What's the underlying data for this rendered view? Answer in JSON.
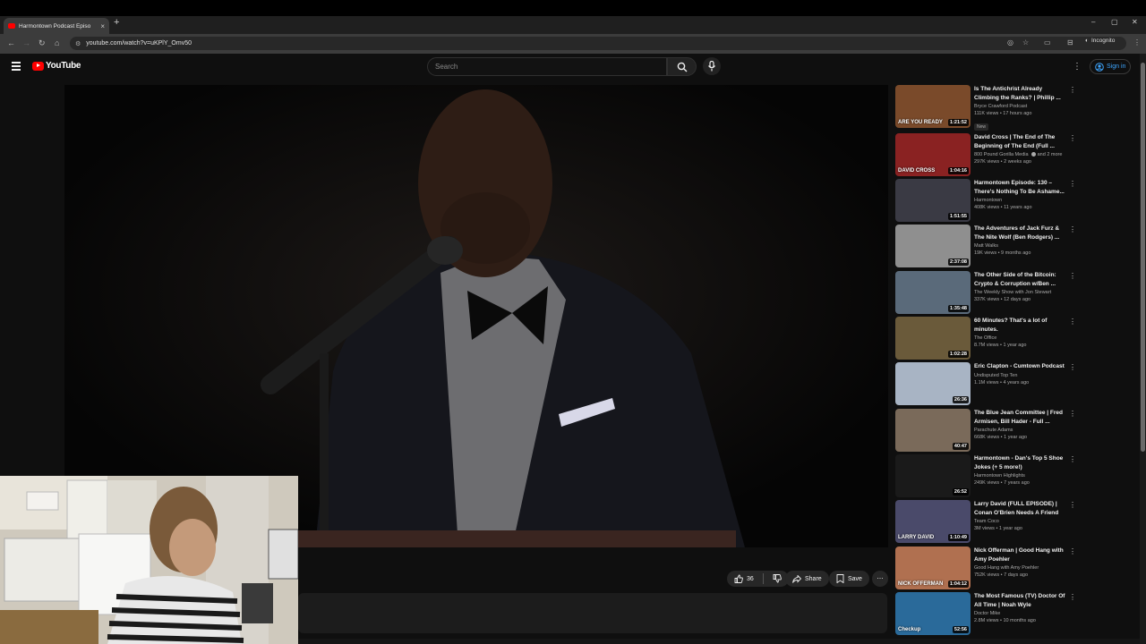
{
  "browser": {
    "tab_title": "Harmontown Podcast Episo",
    "new_tab_symbol": "+",
    "url": "youtube.com/watch?v=uKPlY_Omv50",
    "incognito_label": "Incognito",
    "controls": {
      "minimize": "–",
      "maximize": "▢",
      "close": "✕"
    }
  },
  "header": {
    "logo_text": "YouTube",
    "search_placeholder": "Search",
    "signin_label": "Sign in"
  },
  "actions": {
    "like_count": "36",
    "share_label": "Share",
    "save_label": "Save",
    "more_label": "⋯"
  },
  "icons": {
    "menu": "hamburger-icon",
    "search": "search-icon",
    "mic": "mic-icon",
    "like": "thumbs-up-icon",
    "dislike": "thumbs-down-icon",
    "share": "share-icon",
    "save": "save-icon",
    "more": "more-vert-icon",
    "account": "account-icon"
  },
  "colors": {
    "accent": "#ff0000",
    "link": "#3ea6ff",
    "background": "#0f0f0f"
  },
  "recommendations": [
    {
      "title": "Is The Antichrist Already Climbing the Ranks? | Phillip ...",
      "channel": "Bryce Crawford Podcast",
      "meta": "111K views • 17 hours ago",
      "badge": "New",
      "duration": "1:21:52",
      "thumb_color": "#7a4a2a",
      "thumb_text": "ARE YOU READY"
    },
    {
      "title": "David Cross | The End of The Beginning of The End (Full ...",
      "channel": "800 Pound Gorilla Media",
      "channel_extra": "and 2 more",
      "meta": "297K views • 2 weeks ago",
      "duration": "1:04:16",
      "thumb_color": "#8a2222",
      "thumb_text": "DAVID CROSS"
    },
    {
      "title": "Harmontown Episode: 130 – There's Nothing To Be Ashame...",
      "channel": "Harmontown",
      "meta": "408K views • 11 years ago",
      "duration": "1:51:55",
      "thumb_color": "#3a3a44",
      "thumb_text": ""
    },
    {
      "title": "The Adventures of Jack Furz & The Nite Wolf (Ben Rodgers) ...",
      "channel": "Matt Walks",
      "meta": "19K views • 9 months ago",
      "duration": "2:37:08",
      "thumb_color": "#8f8f8f",
      "thumb_text": ""
    },
    {
      "title": "The Other Side of the Bitcoin: Crypto & Corruption w/Ben ...",
      "channel": "The Weekly Show with Jon Stewart",
      "meta": "337K views • 12 days ago",
      "duration": "1:35:48",
      "thumb_color": "#5a6a7a",
      "thumb_text": ""
    },
    {
      "title": "60 Minutes? That's a lot of minutes.",
      "channel": "The Office",
      "meta": "8.7M views • 1 year ago",
      "duration": "1:02:28",
      "thumb_color": "#6a5a3a",
      "thumb_text": ""
    },
    {
      "title": "Eric Clapton - Cumtown Podcast",
      "channel": "Undisputed Top Ten",
      "meta": "1.1M views • 4 years ago",
      "duration": "26:36",
      "thumb_color": "#a8b4c4",
      "thumb_text": ""
    },
    {
      "title": "The Blue Jean Committee | Fred Armisen, Bill Hader - Full ...",
      "channel": "Parachute Adams",
      "meta": "668K views • 1 year ago",
      "duration": "40:47",
      "thumb_color": "#7a6a5a",
      "thumb_text": ""
    },
    {
      "title": "Harmontown - Dan's Top 5 Shoe Jokes (+ 5 more!)",
      "channel": "Harmontown Highlights",
      "meta": "249K views • 7 years ago",
      "duration": "26:52",
      "thumb_color": "#1a1a1a",
      "thumb_text": ""
    },
    {
      "title": "Larry David (FULL EPISODE) | Conan O'Brien Needs A Friend",
      "channel": "Team Coco",
      "meta": "3M views • 1 year ago",
      "duration": "1:10:49",
      "thumb_color": "#4a4a6a",
      "thumb_text": "LARRY DAVID"
    },
    {
      "title": "Nick Offerman | Good Hang with Amy Poehler",
      "channel": "Good Hang with Amy Poehler",
      "meta": "752K views • 7 days ago",
      "duration": "1:04:12",
      "thumb_color": "#b07050",
      "thumb_text": "NICK OFFERMAN"
    },
    {
      "title": "The Most Famous (TV) Doctor Of All Time | Noah Wyle",
      "channel": "Doctor Mike",
      "meta": "2.8M views • 10 months ago",
      "duration": "52:56",
      "thumb_color": "#2a6a9a",
      "thumb_text": "Checkup"
    }
  ]
}
